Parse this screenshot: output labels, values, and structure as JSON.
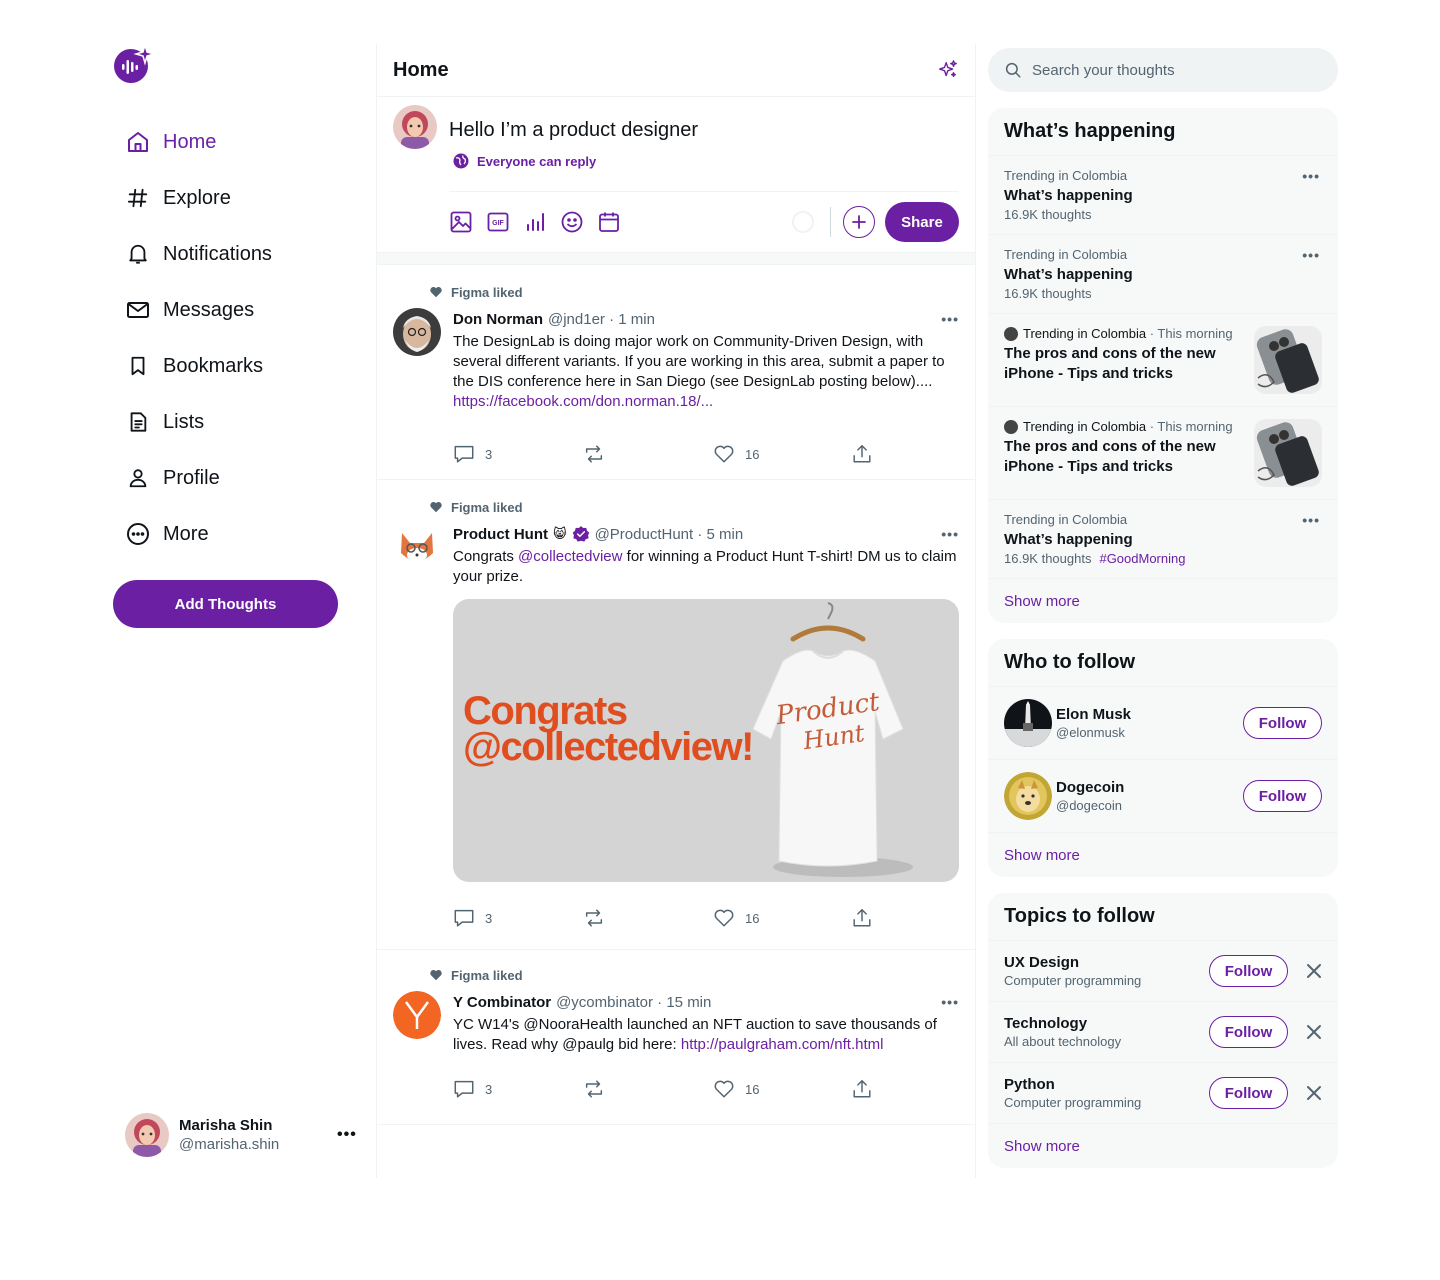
{
  "nav": {
    "items": [
      {
        "label": "Home",
        "icon": "home-icon"
      },
      {
        "label": "Explore",
        "icon": "hashtag-icon"
      },
      {
        "label": "Notifications",
        "icon": "bell-icon"
      },
      {
        "label": "Messages",
        "icon": "mail-icon"
      },
      {
        "label": "Bookmarks",
        "icon": "bookmark-icon"
      },
      {
        "label": "Lists",
        "icon": "list-icon"
      },
      {
        "label": "Profile",
        "icon": "user-icon"
      },
      {
        "label": "More",
        "icon": "more-circle-icon"
      }
    ],
    "add_button": "Add Thoughts"
  },
  "account": {
    "name": "Marisha Shin",
    "handle": "@marisha.shin"
  },
  "center": {
    "title": "Home",
    "composer": {
      "text": "Hello I’m a product designer",
      "reply_setting": "Everyone can reply",
      "share_label": "Share"
    }
  },
  "posts": [
    {
      "context": "Figma liked",
      "author": "Don Norman",
      "meta": "@jnd1er · 1 min",
      "text": "The DesignLab is doing major work on Community-Driven Design, with several different variants. If you are working in this area, submit a paper to the DIS conference here in San Diego (see DesignLab posting below)....",
      "link": "https://facebook.com/don.norman.18/...",
      "replies": "3",
      "likes": "16"
    },
    {
      "context": "Figma liked",
      "author": "Product Hunt",
      "meta": "@ProductHunt · 5 min",
      "text_before": "Congrats ",
      "mention": "@collectedview",
      "text_after": " for winning a Product Hunt T-shirt! DM us to claim your prize.",
      "image_line1": "Congrats",
      "image_line2": "@collectedview!",
      "replies": "3",
      "likes": "16"
    },
    {
      "context": "Figma liked",
      "author": "Y Combinator",
      "meta": "@ycombinator · 15 min",
      "text": "YC W14's @NooraHealth launched an NFT auction to save thousands of lives. Read why @paulg bid here: ",
      "link": "http://paulgraham.com/nft.html",
      "replies": "3",
      "likes": "16"
    }
  ],
  "search": {
    "placeholder": "Search your thoughts"
  },
  "happening": {
    "title": "What’s happening",
    "trends": [
      {
        "context": "Trending in Colombia",
        "title": "What’s happening",
        "count": "16.9K thoughts"
      },
      {
        "context": "Trending in Colombia",
        "title": "What’s happening",
        "count": "16.9K thoughts"
      },
      {
        "context": "Trending in Colombia",
        "time": "· This morning",
        "title": "The pros and cons of the new iPhone - Tips and tricks"
      },
      {
        "context": "Trending in Colombia",
        "time": "· This morning",
        "title": "The pros and cons of the new iPhone - Tips and tricks"
      },
      {
        "context": "Trending in Colombia",
        "title": "What’s happening",
        "count": "16.9K thoughts",
        "tag": "#GoodMorning"
      }
    ],
    "show_more": "Show more"
  },
  "who_to_follow": {
    "title": "Who to follow",
    "users": [
      {
        "name": "Elon Musk",
        "handle": "@elonmusk",
        "button": "Follow"
      },
      {
        "name": "Dogecoin",
        "handle": "@dogecoin",
        "button": "Follow"
      }
    ],
    "show_more": "Show more"
  },
  "topics": {
    "title": "Topics to follow",
    "items": [
      {
        "name": "UX Design",
        "sub": "Computer programming",
        "button": "Follow"
      },
      {
        "name": "Technology",
        "sub": "All about technology",
        "button": "Follow"
      },
      {
        "name": "Python",
        "sub": "Computer programming",
        "button": "Follow"
      }
    ],
    "show_more": "Show more"
  },
  "colors": {
    "accent": "#6b1fa3",
    "text": "#0f1419",
    "muted": "#536471",
    "panel": "#f7f9f9"
  }
}
